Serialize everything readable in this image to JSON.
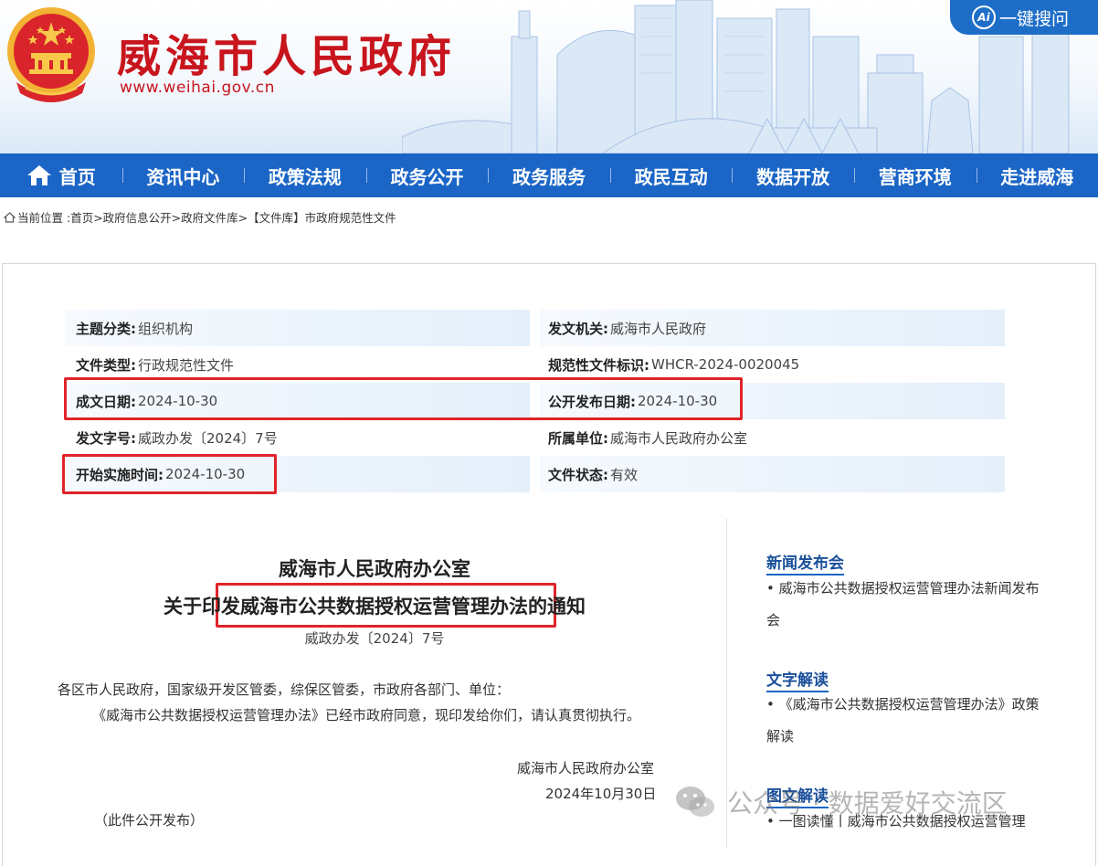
{
  "header": {
    "site_title": "威海市人民政府",
    "site_url": "www.weihai.gov.cn",
    "search_label": "一键搜问",
    "ai_badge": "Ai"
  },
  "nav": {
    "items": [
      "首页",
      "资讯中心",
      "政策法规",
      "政务公开",
      "政务服务",
      "政民互动",
      "数据开放",
      "营商环境",
      "走进威海"
    ]
  },
  "breadcrumb": {
    "prefix": "当前位置 :",
    "items": [
      "首页>",
      "政府信息公开>",
      "政府文件库>",
      "【文件库】市政府规范性文件"
    ]
  },
  "meta": {
    "rows": [
      {
        "left_label": "主题分类:",
        "left_value": "组织机构",
        "right_label": "发文机关:",
        "right_value": "威海市人民政府"
      },
      {
        "left_label": "文件类型:",
        "left_value": "行政规范性文件",
        "right_label": "规范性文件标识:",
        "right_value": "WHCR-2024-0020045"
      },
      {
        "left_label": "成文日期:",
        "left_value": "2024-10-30",
        "right_label": "公开发布日期:",
        "right_value": "2024-10-30"
      },
      {
        "left_label": "发文字号:",
        "left_value": "威政办发〔2024〕7号",
        "right_label": "所属单位:",
        "right_value": "威海市人民政府办公室"
      },
      {
        "left_label": "开始实施时间:",
        "left_value": "2024-10-30",
        "right_label": "文件状态:",
        "right_value": "有效"
      }
    ]
  },
  "article": {
    "title_line1": "威海市人民政府办公室",
    "title_line2": "关于印发威海市公共数据授权运营管理办法的通知",
    "doc_no": "威政办发〔2024〕7号",
    "salutation": "各区市人民政府，国家级开发区管委，综保区管委，市政府各部门、单位：",
    "body": "《威海市公共数据授权运营管理办法》已经市政府同意，现印发给你们，请认真贯彻执行。",
    "signature": "威海市人民政府办公室",
    "date": "2024年10月30日",
    "note": "（此件公开发布）"
  },
  "sidebar": {
    "sections": [
      {
        "heading": "新闻发布会",
        "link": "• 威海市公共数据授权运营管理办法新闻发布会"
      },
      {
        "heading": "文字解读",
        "link": "• 《威海市公共数据授权运营管理办法》政策解读"
      },
      {
        "heading": "图文解读",
        "link": "• 一图读懂丨威海市公共数据授权运营管理"
      }
    ]
  },
  "watermark": {
    "text": "公众号 · 数据爱好交流区"
  },
  "colors": {
    "brand_red": "#c8151d",
    "nav_blue": "#1a65c6",
    "highlight_red": "#e0242a",
    "meta_shade": "#eef5fc"
  },
  "icons": [
    "national-emblem-icon",
    "ai-search-icon",
    "home-icon",
    "location-icon",
    "wechat-icon"
  ]
}
